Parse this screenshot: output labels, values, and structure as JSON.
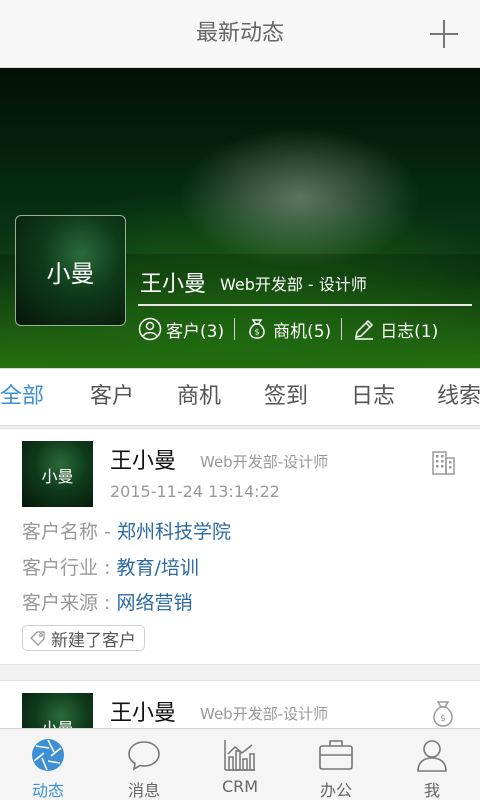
{
  "header": {
    "title": "最新动态",
    "add_icon": "plus-icon"
  },
  "profile": {
    "avatar_text": "小曼",
    "name": "王小曼",
    "department": "Web开发部 - 设计师",
    "stats": [
      {
        "icon": "customer-icon",
        "label": "客户(3)"
      },
      {
        "icon": "money-bag-icon",
        "label": "商机(5)"
      },
      {
        "icon": "pencil-icon",
        "label": "日志(1)"
      }
    ]
  },
  "tabs": [
    {
      "label": "全部",
      "active": true
    },
    {
      "label": "客户"
    },
    {
      "label": "商机"
    },
    {
      "label": "签到"
    },
    {
      "label": "日志"
    },
    {
      "label": "线索"
    }
  ],
  "feed": [
    {
      "avatar_text": "小曼",
      "name": "王小曼",
      "department": "Web开发部-设计师",
      "time": "2015-11-24 13:14:22",
      "type_icon": "building-icon",
      "fields": [
        {
          "label": "客户名称 - ",
          "value": "郑州科技学院"
        },
        {
          "label": "客户行业 : ",
          "value": "教育/培训"
        },
        {
          "label": "客户来源 : ",
          "value": "网络营销"
        }
      ],
      "tag": "新建了客户"
    },
    {
      "avatar_text": "小曼",
      "name": "王小曼",
      "department": "Web开发部-设计师",
      "type_icon": "money-bag-icon"
    }
  ],
  "bottom_nav": [
    {
      "label": "动态",
      "icon": "camera-aperture-icon",
      "active": true
    },
    {
      "label": "消息",
      "icon": "chat-bubble-icon"
    },
    {
      "label": "CRM",
      "icon": "bar-chart-icon"
    },
    {
      "label": "办公",
      "icon": "briefcase-icon"
    },
    {
      "label": "我",
      "icon": "person-icon"
    }
  ],
  "colors": {
    "accent": "#3d8fd6",
    "link": "#2c6aa6",
    "muted": "#999999"
  }
}
